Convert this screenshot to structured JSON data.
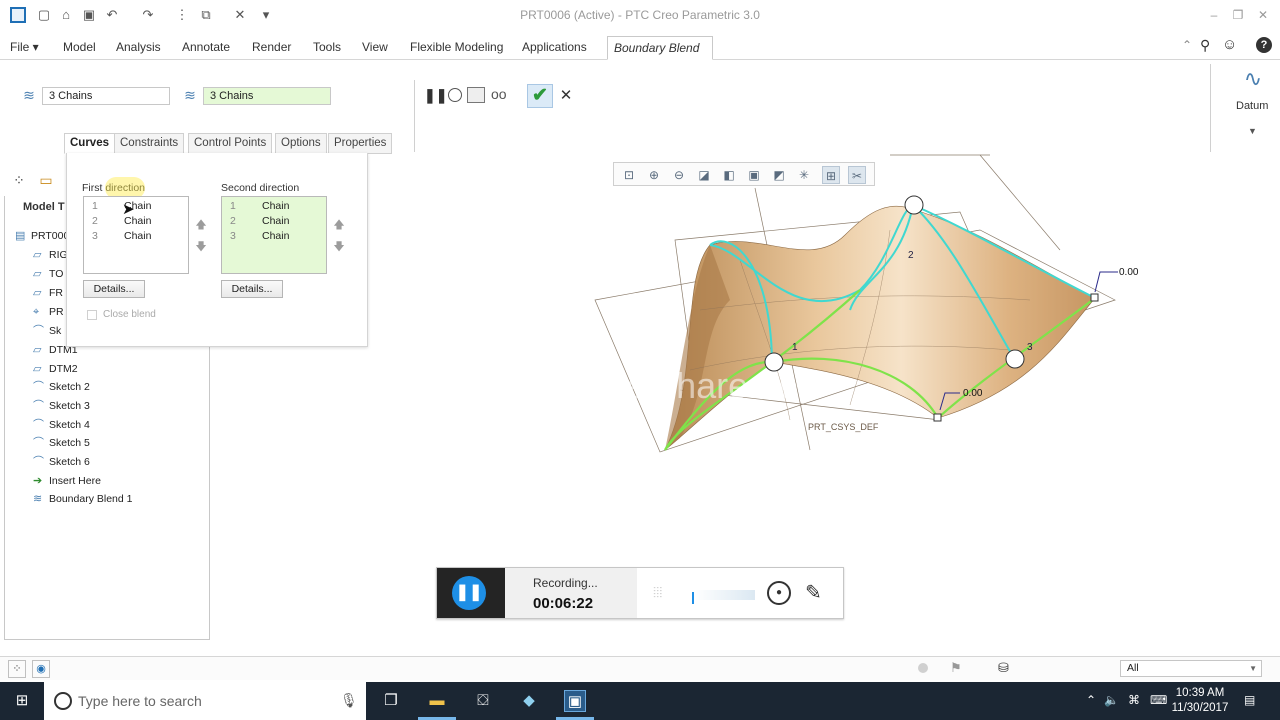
{
  "window": {
    "title": "PRT0006 (Active) - PTC Creo Parametric 3.0"
  },
  "ribbon": {
    "tabs": [
      {
        "label": "File ▾"
      },
      {
        "label": "Model"
      },
      {
        "label": "Analysis"
      },
      {
        "label": "Annotate"
      },
      {
        "label": "Render"
      },
      {
        "label": "Tools"
      },
      {
        "label": "View"
      },
      {
        "label": "Flexible Modeling"
      },
      {
        "label": "Applications"
      },
      {
        "label": "Boundary Blend"
      }
    ]
  },
  "dashboard": {
    "first_chains": "3 Chains",
    "second_chains": "3 Chains",
    "datum_label": "Datum"
  },
  "subtabs": [
    {
      "label": "Curves"
    },
    {
      "label": "Constraints"
    },
    {
      "label": "Control Points"
    },
    {
      "label": "Options"
    },
    {
      "label": "Properties"
    }
  ],
  "curves_panel": {
    "first_direction_label": "First direction",
    "second_direction_label": "Second direction",
    "first_rows": [
      {
        "num": "1",
        "label": "Chain"
      },
      {
        "num": "2",
        "label": "Chain"
      },
      {
        "num": "3",
        "label": "Chain"
      }
    ],
    "second_rows": [
      {
        "num": "1",
        "label": "Chain"
      },
      {
        "num": "2",
        "label": "Chain"
      },
      {
        "num": "3",
        "label": "Chain"
      }
    ],
    "details_label": "Details...",
    "close_blend_label": "Close blend"
  },
  "model_tree": {
    "header": "Model T",
    "items": [
      {
        "label": "PRT000",
        "icon": "part-icon"
      },
      {
        "label": "RIG",
        "icon": "plane-icon"
      },
      {
        "label": "TO",
        "icon": "plane-icon"
      },
      {
        "label": "FR",
        "icon": "plane-icon"
      },
      {
        "label": "PR",
        "icon": "csys-icon"
      },
      {
        "label": "Sk",
        "icon": "sketch-icon"
      },
      {
        "label": "DTM1",
        "icon": "plane-icon"
      },
      {
        "label": "DTM2",
        "icon": "plane-icon"
      },
      {
        "label": "Sketch 2",
        "icon": "sketch-icon"
      },
      {
        "label": "Sketch 3",
        "icon": "sketch-icon"
      },
      {
        "label": "Sketch 4",
        "icon": "sketch-icon"
      },
      {
        "label": "Sketch 5",
        "icon": "sketch-icon"
      },
      {
        "label": "Sketch 6",
        "icon": "sketch-icon"
      },
      {
        "label": "Insert Here",
        "icon": "insert-arrow-icon"
      },
      {
        "label": "Boundary Blend 1",
        "icon": "boundary-blend-icon"
      }
    ]
  },
  "viewport": {
    "csys_label": "PRT_CSYS_DEF",
    "dim_labels": [
      "0.00",
      "0.00"
    ],
    "chain_numbers": [
      "1",
      "2",
      "3"
    ],
    "watermark": "www.thundershare.net"
  },
  "recorder": {
    "status": "Recording...",
    "time": "00:06:22"
  },
  "statusbar": {
    "filter": "All"
  },
  "taskbar": {
    "search_placeholder": "Type here to search",
    "time": "10:39 AM",
    "date": "11/30/2017"
  },
  "colors": {
    "surface": "#e2b98a",
    "chain_first": "#40d8d0",
    "chain_second": "#7fe34a",
    "accent": "#1e8fe6"
  }
}
